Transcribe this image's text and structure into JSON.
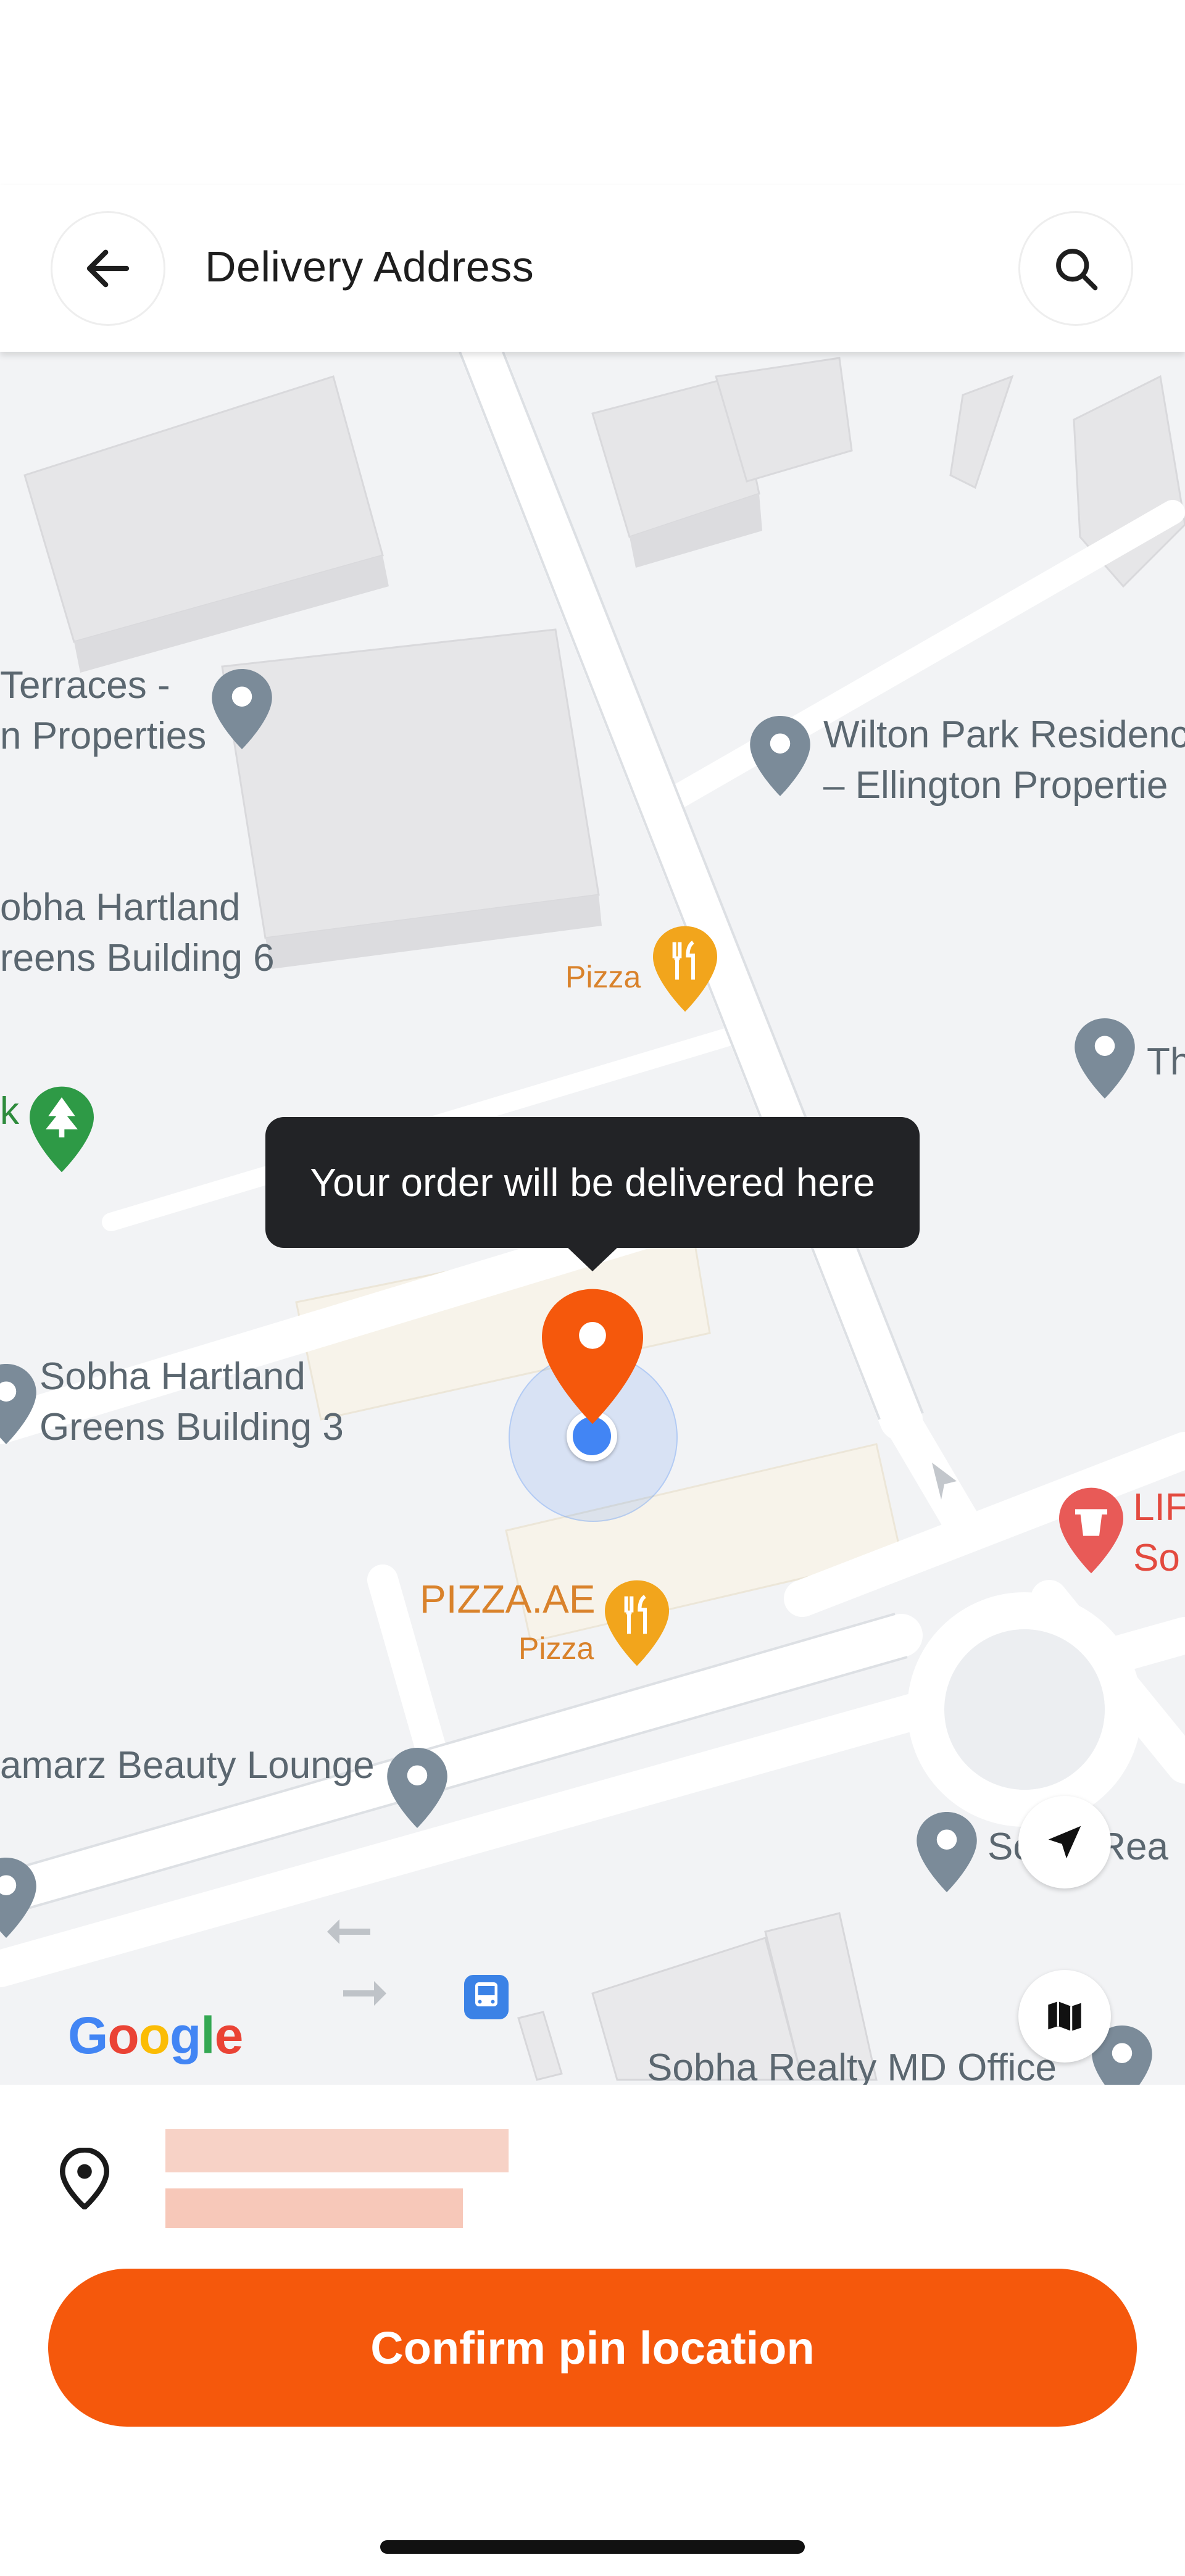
{
  "header": {
    "title": "Delivery Address",
    "back_icon": "arrow-left-icon",
    "search_icon": "search-icon"
  },
  "map": {
    "pois": {
      "terraces": "Terraces -\nn Properties",
      "wilton": "Wilton Park Residenc\n– Ellington Propertie",
      "sobha6": "obha Hartland\nreens Building 6",
      "pizza_small": "Pizza",
      "th": "Th",
      "k": "k",
      "sobha3": "Sobha Hartland\nGreens Building 3",
      "lif": "LIF\nSo",
      "pizzaae": "PIZZA.AE",
      "pizzaae_sub": "Pizza",
      "beauty": "amarz Beauty Lounge",
      "sobha_realty": "So      Rea",
      "sobha_md": "Sobha Realty MD Office"
    },
    "tooltip": "Your order will be delivered here",
    "google_logo": [
      "G",
      "o",
      "o",
      "g",
      "l",
      "e"
    ],
    "google_colors": [
      "#4285F4",
      "#EA4335",
      "#FBBC05",
      "#4285F4",
      "#34A853",
      "#EA4335"
    ],
    "pin_color": "#f5580c",
    "my_location_icon": "navigation-arrow-icon",
    "map_type_icon": "map-icon"
  },
  "bottom": {
    "location_icon": "location-pin-icon",
    "confirm_label": "Confirm pin location",
    "accent": "#f5580c"
  }
}
